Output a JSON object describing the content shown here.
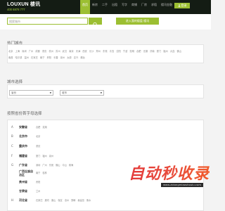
{
  "header": {
    "logo": "LOUXUN 楼讯",
    "phone": "400 6878 777",
    "nav": [
      "首页",
      "新房",
      "二手",
      "出租",
      "写字",
      "商铺",
      "厂房",
      "求租",
      "楼讯金融"
    ],
    "login": "登录"
  },
  "search": {
    "placeholder": "搜索城市",
    "add_button": "进入我的楼盘 楼讯"
  },
  "hot_city": {
    "title": "热门城市",
    "row1": [
      "北京",
      "上海",
      "深圳",
      "广州",
      "成都",
      "重庆",
      "杭州",
      "苏州",
      "武汉",
      "南京",
      "天津",
      "西安",
      "长沙",
      "郑州",
      "东莞",
      "青岛",
      "沈阳",
      "宁波",
      "昆明",
      "合肥",
      "无锡",
      "济南",
      "厦门",
      "福州",
      "大连",
      "佛山"
    ],
    "row2": [
      "南昌",
      "哈尔滨",
      "温州",
      "石家庄",
      "南宁",
      "贵阳",
      "长春",
      "泉州",
      "太原",
      "嘉兴",
      "烟台"
    ]
  },
  "region": {
    "title": "城市选择",
    "province_select": "省份",
    "city_select": "城市"
  },
  "provinces": {
    "title": "按照省份首字母选择",
    "rows": [
      {
        "letter": "A",
        "name": "安徽省",
        "cities": [
          "合肥",
          "芜湖"
        ]
      },
      {
        "letter": "B",
        "name": "北京市",
        "cities": [
          "北京"
        ]
      },
      {
        "letter": "C",
        "name": "重庆市",
        "cities": [
          "重庆"
        ]
      },
      {
        "letter": "F",
        "name": "福建省",
        "cities": [
          "厦门",
          "福州",
          "泉州"
        ]
      },
      {
        "letter": "G",
        "name": "广东省",
        "cities": [
          "深圳",
          "广州",
          "东莞",
          "佛山",
          "中山",
          "珠海"
        ]
      },
      {
        "letter": "",
        "name": "广西壮族自治区",
        "cities": [
          "南宁",
          "桂林"
        ]
      },
      {
        "letter": "",
        "name": "贵州省",
        "cities": [
          "贵阳"
        ]
      },
      {
        "letter": "",
        "name": "甘肃省",
        "cities": [
          "兰州"
        ]
      },
      {
        "letter": "H",
        "name": "河北省",
        "cities": [
          "石家庄",
          "廊坊",
          "唐山",
          "保定",
          "沧州",
          "邯郸",
          "秦皇岛",
          "衡水"
        ]
      }
    ]
  },
  "watermark": {
    "big": "自动秒收录",
    "small": "www.zidongmiaoshoulu.com"
  }
}
